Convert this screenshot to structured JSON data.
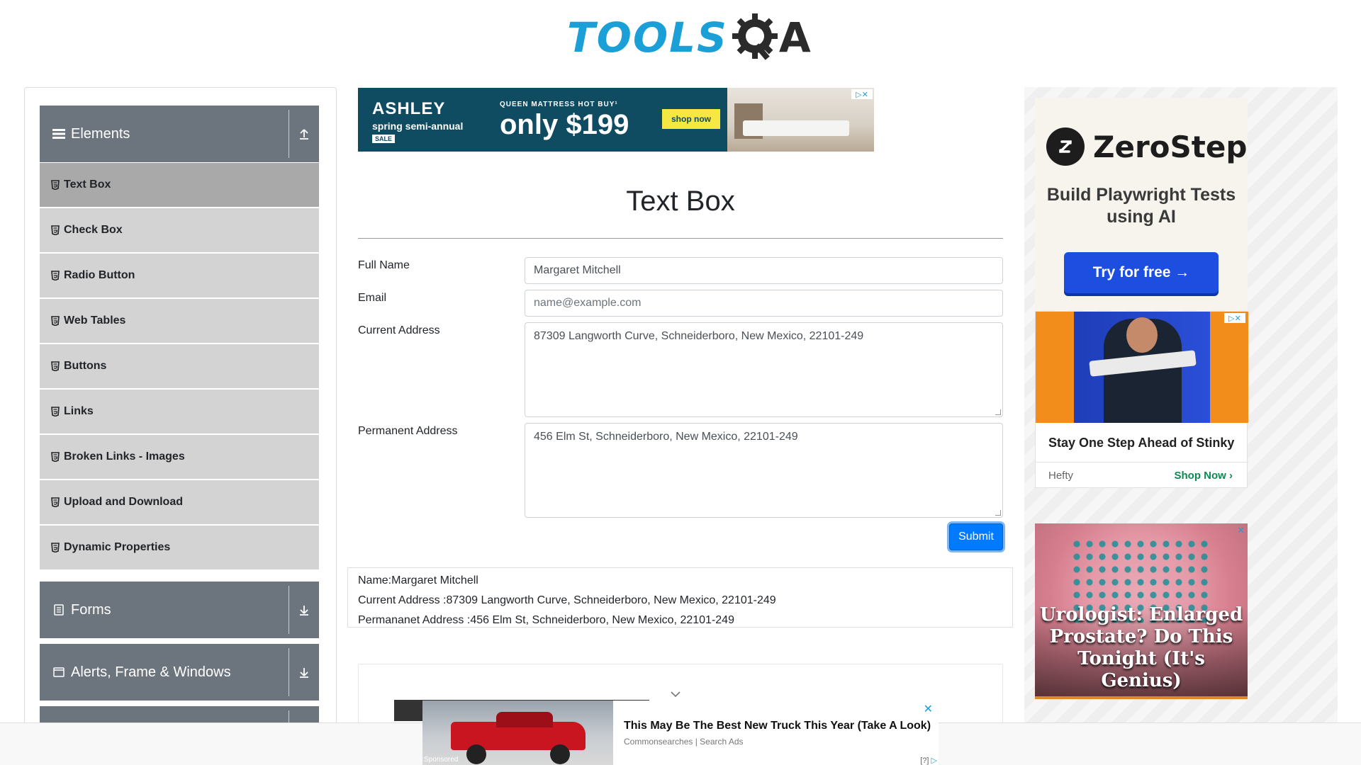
{
  "header": {
    "logo_tools": "TOOLS",
    "logo_a": "A"
  },
  "sidebar": {
    "groups": [
      {
        "label": "Elements",
        "icon": "hamburger-icon",
        "arrow": "collapse-arrow-icon"
      },
      {
        "label": "Forms",
        "icon": "form-icon",
        "arrow": "expand-arrow-icon"
      },
      {
        "label": "Alerts, Frame & Windows",
        "icon": "window-icon",
        "arrow": "expand-arrow-icon"
      }
    ],
    "items": [
      {
        "label": "Text Box",
        "active": true
      },
      {
        "label": "Check Box"
      },
      {
        "label": "Radio Button"
      },
      {
        "label": "Web Tables"
      },
      {
        "label": "Buttons"
      },
      {
        "label": "Links"
      },
      {
        "label": "Broken Links - Images"
      },
      {
        "label": "Upload and Download"
      },
      {
        "label": "Dynamic Properties"
      }
    ]
  },
  "top_ad": {
    "brand": "ASHLEY",
    "sub": "spring semi-annual",
    "sale": "SALE",
    "offer_small": "QUEEN MATTRESS HOT BUY¹",
    "offer_big": "only $199",
    "cta": "shop now"
  },
  "main": {
    "title": "Text Box",
    "full_name_label": "Full Name",
    "full_name_value": "Margaret Mitchell",
    "email_label": "Email",
    "email_placeholder": "name@example.com",
    "current_address_label": "Current Address",
    "current_address_value": "87309 Langworth Curve, Schneiderboro, New Mexico, 22101-249",
    "permanent_address_label": "Permanent Address",
    "permanent_address_value": "456 Elm St, Schneiderboro, New Mexico, 22101-249",
    "submit_label": "Submit"
  },
  "output": {
    "name": "Name:Margaret Mitchell",
    "current_address": "Current Address :87309 Langworth Curve, Schneiderboro, New Mexico, 22101-249",
    "permanent_address": "Permananet Address :456 Elm St, Schneiderboro, New Mexico, 22101-249"
  },
  "right_ads": {
    "zerostep_name": "ZeroStep",
    "zerostep_tagline": "Build Playwright Tests using AI",
    "zerostep_cta": "Try for free →",
    "hefty_title": "Stay One Step Ahead of Stinky",
    "hefty_brand": "Hefty",
    "hefty_cta": "Shop Now ›",
    "urology_text": "Urologist: Enlarged Prostate? Do This Tonight (It's Genius)"
  },
  "sticky_ad": {
    "title": "This May Be The Best New Truck This Year (Take A Look)",
    "source": "Commonsearches | Search Ads",
    "sponsored": "Sponsored",
    "info": "[?]"
  },
  "colors": {
    "accent": "#007bff",
    "sidebar_group": "#6c757d",
    "sidebar_item": "#d3d3d3",
    "sidebar_active": "#a9a9a9",
    "logo_blue": "#1a9fd6"
  }
}
